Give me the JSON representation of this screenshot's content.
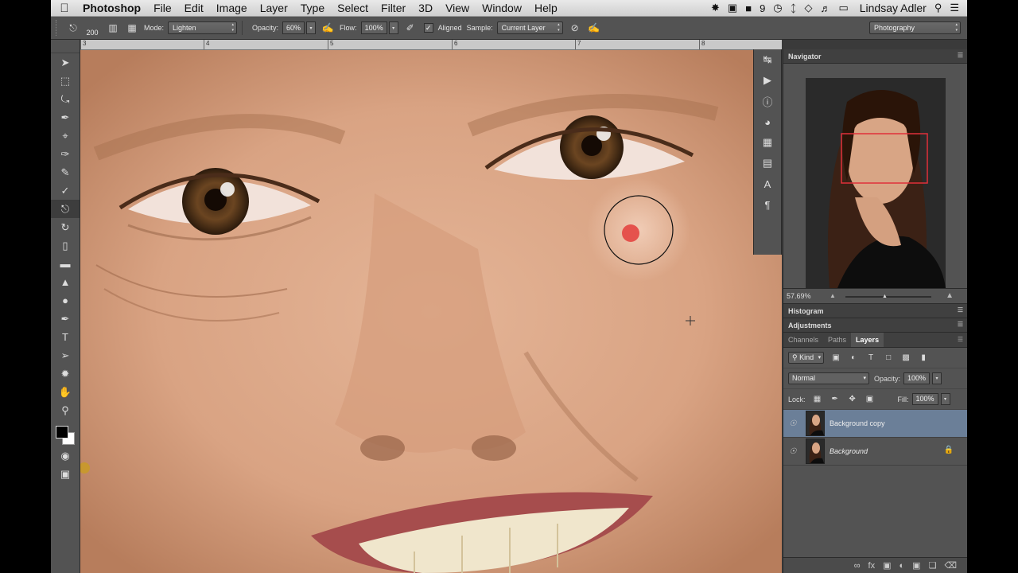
{
  "menubar": {
    "app_name": "Photoshop",
    "items": [
      "File",
      "Edit",
      "Image",
      "Layer",
      "Type",
      "Select",
      "Filter",
      "3D",
      "View",
      "Window",
      "Help"
    ],
    "status_number": "9",
    "user": "Lindsay Adler"
  },
  "options": {
    "brush_size": "200",
    "mode_label": "Mode:",
    "mode_value": "Lighten",
    "opacity_label": "Opacity:",
    "opacity_value": "60%",
    "flow_label": "Flow:",
    "flow_value": "100%",
    "aligned_label": "Aligned",
    "sample_label": "Sample:",
    "sample_value": "Current Layer",
    "workspace": "Photography"
  },
  "ruler": {
    "ticks": [
      "3",
      "4",
      "5",
      "6",
      "7",
      "8"
    ]
  },
  "navigator": {
    "title": "Navigator",
    "zoom": "57.69%"
  },
  "collapsed_panels": {
    "histogram": "Histogram",
    "adjustments": "Adjustments"
  },
  "layers_panel": {
    "tabs": [
      "Channels",
      "Paths",
      "Layers"
    ],
    "filter_label": "Kind",
    "blend_mode": "Normal",
    "opacity_label": "Opacity:",
    "opacity_value": "100%",
    "lock_label": "Lock:",
    "fill_label": "Fill:",
    "fill_value": "100%",
    "layers": [
      {
        "name": "Background copy"
      },
      {
        "name": "Background"
      }
    ]
  },
  "icons": {
    "tools": [
      "move-tool-icon",
      "marquee-tool-icon",
      "lasso-tool-icon",
      "quick-select-tool-icon",
      "crop-tool-icon",
      "eyedropper-tool-icon",
      "healing-brush-tool-icon",
      "brush-tool-icon",
      "clone-stamp-tool-icon",
      "history-brush-tool-icon",
      "eraser-tool-icon",
      "gradient-tool-icon",
      "blur-tool-icon",
      "dodge-tool-icon",
      "pen-tool-icon",
      "type-tool-icon",
      "path-select-tool-icon",
      "shape-tool-icon",
      "hand-tool-icon",
      "zoom-tool-icon"
    ]
  },
  "colors": {
    "foreground": "#000000",
    "background": "#ffffff",
    "nav_view_box": "#e0303a",
    "selected_layer": "#6b7f98"
  }
}
